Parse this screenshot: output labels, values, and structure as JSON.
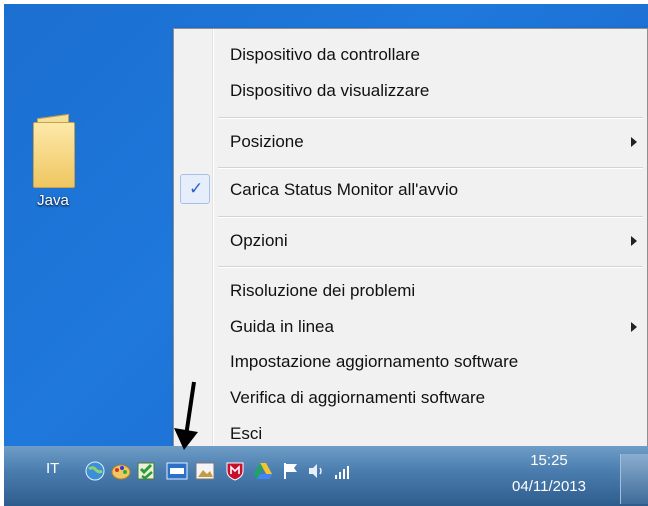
{
  "desktop": {
    "icons": [
      {
        "label": "Java",
        "icon": "folder-icon"
      }
    ]
  },
  "context_menu": {
    "items": [
      {
        "label": "Dispositivo da controllare",
        "submenu": false,
        "checked": false
      },
      {
        "label": "Dispositivo da visualizzare",
        "submenu": false,
        "checked": false
      },
      {
        "label": "Posizione",
        "submenu": true,
        "checked": false
      },
      {
        "label": "Carica Status Monitor all'avvio",
        "submenu": false,
        "checked": true
      },
      {
        "label": "Opzioni",
        "submenu": true,
        "checked": false
      },
      {
        "label": "Risoluzione dei problemi",
        "submenu": false,
        "checked": false
      },
      {
        "label": "Guida in linea",
        "submenu": true,
        "checked": false
      },
      {
        "label": "Impostazione aggiornamento software",
        "submenu": false,
        "checked": false
      },
      {
        "label": "Verifica di aggiornamenti software",
        "submenu": false,
        "checked": false
      },
      {
        "label": "Esci",
        "submenu": false,
        "checked": false
      }
    ],
    "check_glyph": "✓"
  },
  "taskbar": {
    "language": "IT",
    "tray_icons": [
      "network-globe-icon",
      "paint-palette-icon",
      "status-monitor-icon",
      "ccs-icon",
      "photo-icon",
      "mcafee-shield-icon",
      "google-drive-icon",
      "action-center-flag-icon",
      "volume-icon",
      "signal-icon"
    ],
    "clock_time": "15:25",
    "clock_date": "04/11/2013"
  },
  "colors": {
    "desktop": "#1f78dc",
    "menu_background": "#f1f1f1",
    "check_highlight": "#e6eefb",
    "taskbar": "#4b7eb0"
  }
}
